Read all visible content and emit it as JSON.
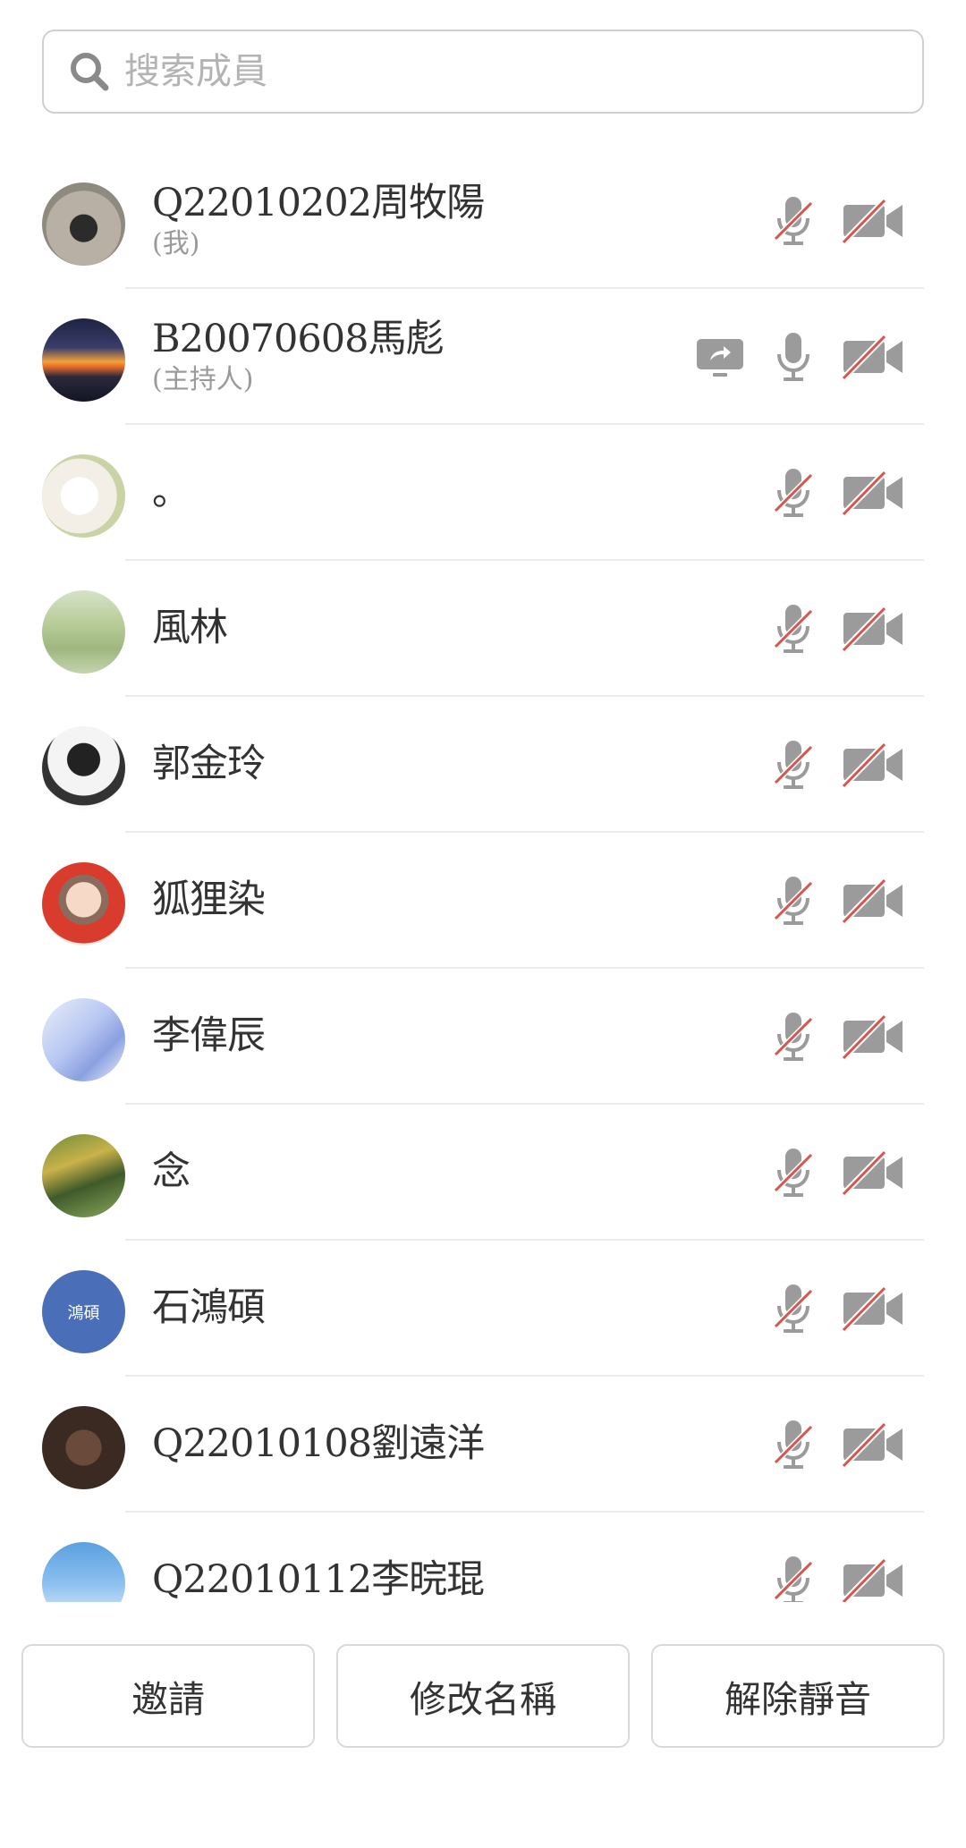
{
  "search": {
    "placeholder": "搜索成員",
    "icon": "search-icon"
  },
  "colors": {
    "muted_red": "#d9534f",
    "icon_gray": "#9b9b9b",
    "default_avatar_blue": "#4a6fb8"
  },
  "members": [
    {
      "name": "Q22010202周牧陽",
      "role": "(我)",
      "sharing": false,
      "mic_muted": true,
      "video_off": true,
      "avatar_text": ""
    },
    {
      "name": "B20070608馬彪",
      "role": "(主持人)",
      "sharing": true,
      "mic_muted": false,
      "video_off": true,
      "avatar_text": ""
    },
    {
      "name": "。",
      "role": "",
      "sharing": false,
      "mic_muted": true,
      "video_off": true,
      "avatar_text": ""
    },
    {
      "name": "風林",
      "role": "",
      "sharing": false,
      "mic_muted": true,
      "video_off": true,
      "avatar_text": ""
    },
    {
      "name": "郭金玲",
      "role": "",
      "sharing": false,
      "mic_muted": true,
      "video_off": true,
      "avatar_text": ""
    },
    {
      "name": "狐狸染",
      "role": "",
      "sharing": false,
      "mic_muted": true,
      "video_off": true,
      "avatar_text": ""
    },
    {
      "name": "李偉辰",
      "role": "",
      "sharing": false,
      "mic_muted": true,
      "video_off": true,
      "avatar_text": ""
    },
    {
      "name": "念",
      "role": "",
      "sharing": false,
      "mic_muted": true,
      "video_off": true,
      "avatar_text": ""
    },
    {
      "name": "石鴻碩",
      "role": "",
      "sharing": false,
      "mic_muted": true,
      "video_off": true,
      "avatar_text": "鴻碩"
    },
    {
      "name": "Q22010108劉遠洋",
      "role": "",
      "sharing": false,
      "mic_muted": true,
      "video_off": true,
      "avatar_text": ""
    },
    {
      "name": "Q22010112李晥琨",
      "role": "",
      "sharing": false,
      "mic_muted": true,
      "video_off": true,
      "avatar_text": ""
    }
  ],
  "actions": {
    "invite": "邀請",
    "rename": "修改名稱",
    "unmute": "解除靜音"
  }
}
